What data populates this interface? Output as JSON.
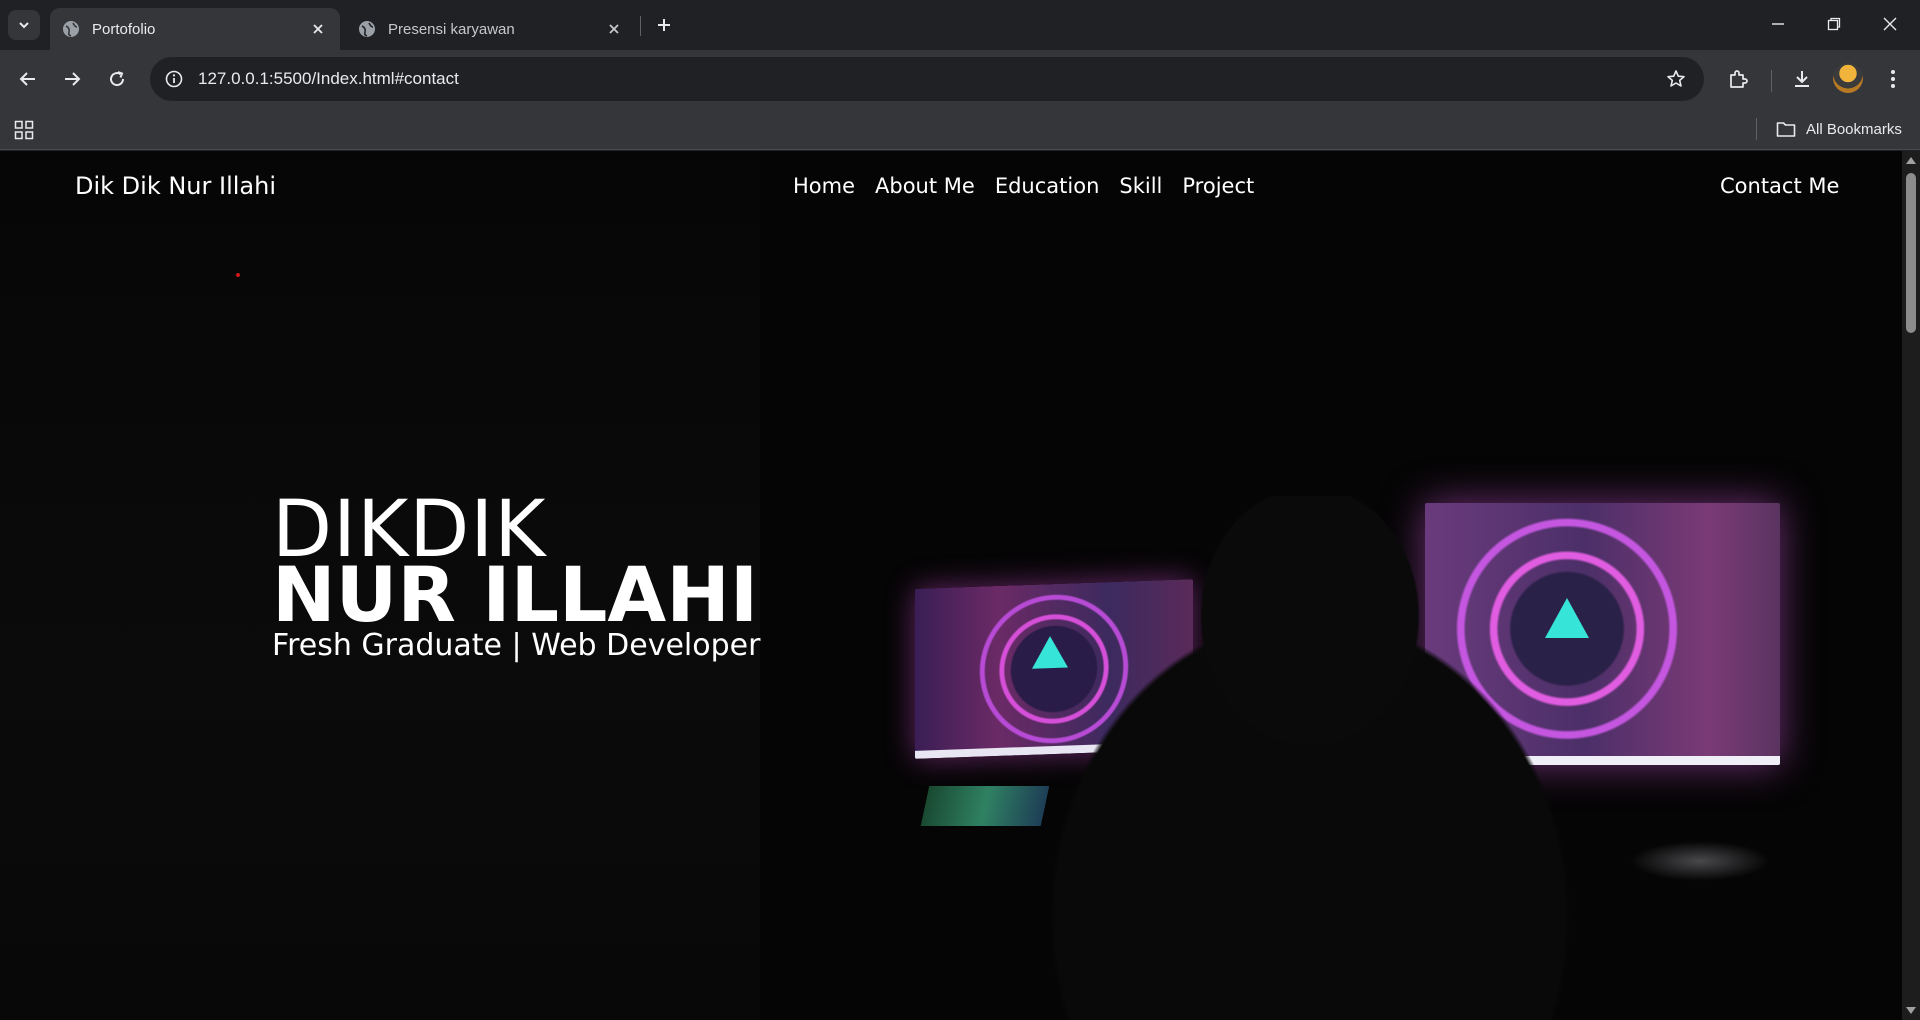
{
  "browser": {
    "tabs": [
      {
        "title": "Portofolio",
        "active": true
      },
      {
        "title": "Presensi karyawan",
        "active": false
      }
    ],
    "url": "127.0.0.1:5500/Index.html#contact",
    "bookmarks_label": "All Bookmarks"
  },
  "site": {
    "brand": "Dik Dik Nur Illahi",
    "nav": [
      "Home",
      "About Me",
      "Education",
      "Skill",
      "Project"
    ],
    "contact": "Contact Me",
    "hero": {
      "first_name": "DIKDIK",
      "last_name": "NUR ILLAHI",
      "role": "Fresh Graduate | Web Developer"
    }
  },
  "colors": {
    "chrome_bg": "#202124",
    "toolbar_bg": "#35363a",
    "page_bg": "#050505",
    "text": "#ffffff",
    "screen_glow": "#d54fd8"
  }
}
